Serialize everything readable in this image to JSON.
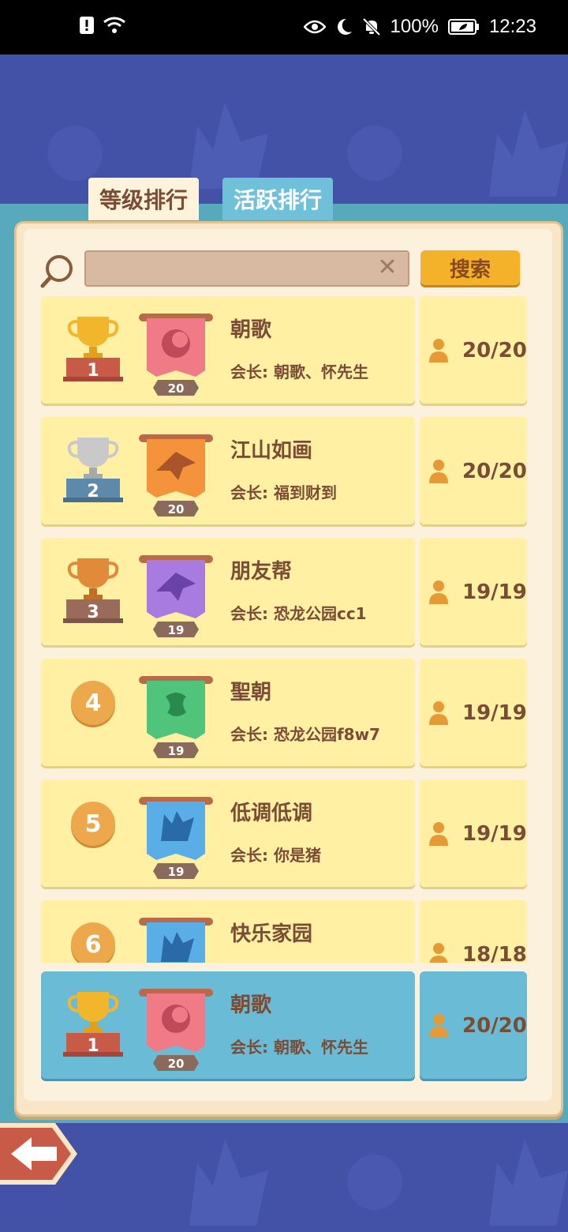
{
  "status_bar": {
    "battery": "100%",
    "time": "12:23"
  },
  "tabs": [
    {
      "label": "等级排行",
      "active": false
    },
    {
      "label": "活跃排行",
      "active": true
    }
  ],
  "search": {
    "placeholder": "",
    "button_label": "搜索"
  },
  "rankings": [
    {
      "rank": "1",
      "name": "朝歌",
      "leader": "会长: 朝歌、怀先生",
      "level": "20",
      "members": "20/20",
      "banner_color": "#f07b86",
      "emblem": "moon-emblem-icon",
      "trophy": "gold"
    },
    {
      "rank": "2",
      "name": "江山如画",
      "leader": "会长: 福到财到",
      "level": "20",
      "members": "20/20",
      "banner_color": "#f5923c",
      "emblem": "eagle-emblem-icon",
      "trophy": "silver"
    },
    {
      "rank": "3",
      "name": "朋友帮",
      "leader": "会长: 恐龙公园cc1",
      "level": "19",
      "members": "19/19",
      "banner_color": "#a77be0",
      "emblem": "eagle-emblem-icon",
      "trophy": "bronze"
    },
    {
      "rank": "4",
      "name": "聖朝",
      "leader": "会长: 恐龙公园f8w7",
      "level": "19",
      "members": "19/19",
      "banner_color": "#4fc47a",
      "emblem": "rune-emblem-icon",
      "trophy": ""
    },
    {
      "rank": "5",
      "name": "低调低调",
      "leader": "会长: 你是猪",
      "level": "19",
      "members": "19/19",
      "banner_color": "#5aaee8",
      "emblem": "wolf-emblem-icon",
      "trophy": ""
    },
    {
      "rank": "6",
      "name": "快乐家园",
      "leader": "",
      "level": "",
      "members": "18/18",
      "banner_color": "#5aaee8",
      "emblem": "wolf-emblem-icon",
      "trophy": ""
    }
  ],
  "self_rank": {
    "rank": "1",
    "name": "朝歌",
    "leader": "会长: 朝歌、怀先生",
    "level": "20",
    "members": "20/20",
    "banner_color": "#f07b86"
  },
  "colors": {
    "accent": "#6fc0d9",
    "row_bg": "#fff0a3",
    "text": "#7a4b35",
    "search_button": "#f3b22a",
    "background": "#4352a6"
  }
}
